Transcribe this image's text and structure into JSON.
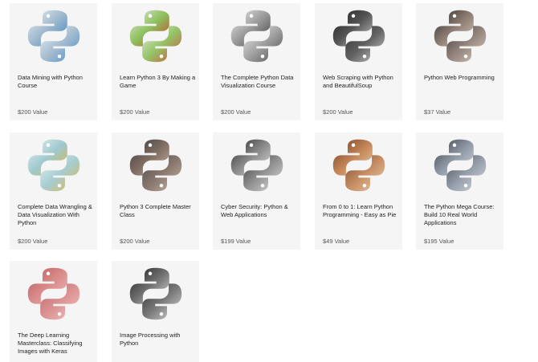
{
  "courses": [
    {
      "title": "Data Mining with Python Course",
      "value": "$200 Value",
      "icon": "data-mining-photo-icon",
      "colors": [
        "#e9f2f8",
        "#9fb8cc",
        "#3a82c4"
      ]
    },
    {
      "title": "Learn Python 3 By Making a Game",
      "value": "$200 Value",
      "icon": "game-pieces-photo-icon",
      "colors": [
        "#ecebe4",
        "#8bbf5a",
        "#d43a2f"
      ]
    },
    {
      "title": "The Complete Python Data Visualization Course",
      "value": "$200 Value",
      "icon": "laptop-chart-photo-icon",
      "colors": [
        "#ececec",
        "#9a9a9a",
        "#3d3d3d"
      ]
    },
    {
      "title": "Web Scraping with Python and BeautifulSoup",
      "value": "$200 Value",
      "icon": "spider-web-photo-icon",
      "colors": [
        "#1e1e1e",
        "#555555",
        "#cfcfcf"
      ]
    },
    {
      "title": "Python Web Programming",
      "value": "$37 Value",
      "icon": "laptop-hands-photo-icon",
      "colors": [
        "#2e2a2b",
        "#8c7c72",
        "#d7cbbf"
      ]
    },
    {
      "title": "Complete Data Wrangling & Data Visualization With Python",
      "value": "$200 Value",
      "icon": "charts-desk-photo-icon",
      "colors": [
        "#eef3f3",
        "#9ec9cf",
        "#e0b23a"
      ]
    },
    {
      "title": "Python 3 Complete Master Class",
      "value": "$200 Value",
      "icon": "laptop-desk-photo-icon",
      "colors": [
        "#3a3a3e",
        "#7f6c62",
        "#c9b5a3"
      ]
    },
    {
      "title": "Cyber Security: Python & Web Applications",
      "value": "$199 Value",
      "icon": "chain-lock-photo-icon",
      "colors": [
        "#2a2a2a",
        "#8a8a8a",
        "#e0e0e0"
      ]
    },
    {
      "title": "From 0 to 1: Learn Python Programming - Easy as Pie",
      "value": "$49 Value",
      "icon": "pie-photo-icon",
      "colors": [
        "#6a3a22",
        "#c28456",
        "#e9cfa8"
      ]
    },
    {
      "title": "The Python Mega Course: Build 10 Real World Applications",
      "value": "$195 Value",
      "icon": "phone-hand-photo-icon",
      "colors": [
        "#3b3e45",
        "#8d96a3",
        "#d6dbe2"
      ]
    },
    {
      "title": "The Deep Learning Masterclass: Classifying Images with Keras",
      "value": "",
      "icon": "brain-photo-icon",
      "colors": [
        "#b85a5e",
        "#d98a8a",
        "#f0c0bd"
      ]
    },
    {
      "title": "Image Processing with Python",
      "value": "",
      "icon": "photo-prints-photo-icon",
      "colors": [
        "#1e1e1e",
        "#6f6f6f",
        "#dcdcdc"
      ]
    }
  ]
}
